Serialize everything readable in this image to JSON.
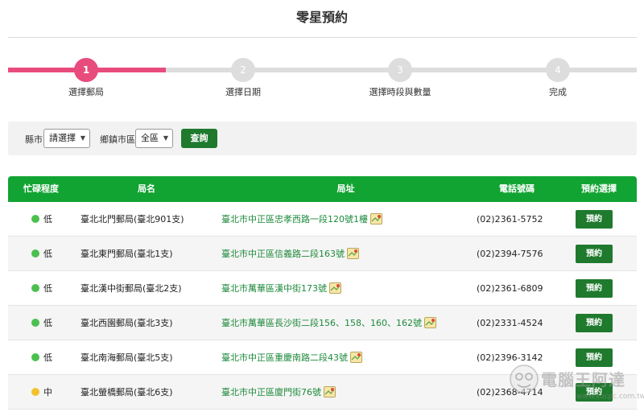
{
  "page": {
    "title": "零星預約"
  },
  "stepper": {
    "steps": [
      {
        "number": "1",
        "label": "選擇郵局"
      },
      {
        "number": "2",
        "label": "選擇日期"
      },
      {
        "number": "3",
        "label": "選擇時段與數量"
      },
      {
        "number": "4",
        "label": "完成"
      }
    ],
    "active_step": 1
  },
  "filter": {
    "county_label": "縣市",
    "county_value": "請選擇",
    "district_label": "鄉鎮市區",
    "district_value": "全區",
    "query_label": "查詢"
  },
  "table": {
    "headers": [
      "忙碌程度",
      "局名",
      "局址",
      "電話號碼",
      "預約選擇"
    ],
    "rows": [
      {
        "busy": "低",
        "name": "臺北北門郵局(臺北901支)",
        "address": "臺北市中正區忠孝西路一段120號1樓",
        "phone": "(02)2361-5752",
        "action": "預約"
      },
      {
        "busy": "低",
        "name": "臺北東門郵局(臺北1支)",
        "address": "臺北市中正區信義路二段163號",
        "phone": "(02)2394-7576",
        "action": "預約"
      },
      {
        "busy": "低",
        "name": "臺北漢中街郵局(臺北2支)",
        "address": "臺北市萬華區漢中街173號",
        "phone": "(02)2361-6809",
        "action": "預約"
      },
      {
        "busy": "低",
        "name": "臺北西園郵局(臺北3支)",
        "address": "臺北市萬華區長沙街二段156、158、160、162號",
        "phone": "(02)2331-4524",
        "action": "預約"
      },
      {
        "busy": "低",
        "name": "臺北南海郵局(臺北5支)",
        "address": "臺北市中正區重慶南路二段43號",
        "phone": "(02)2396-3142",
        "action": "預約"
      },
      {
        "busy": "中",
        "name": "臺北螢橋郵局(臺北6支)",
        "address": "臺北市中正區廈門街76號",
        "phone": "(02)2368-4714",
        "action": "預約"
      }
    ]
  },
  "colors": {
    "accent_pink": "#e84c7d",
    "header_green": "#12a433",
    "button_green": "#1f7a2e",
    "link_green": "#1e8a3c",
    "busy_low": "#4cc04f",
    "busy_medium": "#f2c12e"
  },
  "watermark": {
    "text": "電腦王阿達",
    "url": "www.kocpc.com.tw"
  }
}
